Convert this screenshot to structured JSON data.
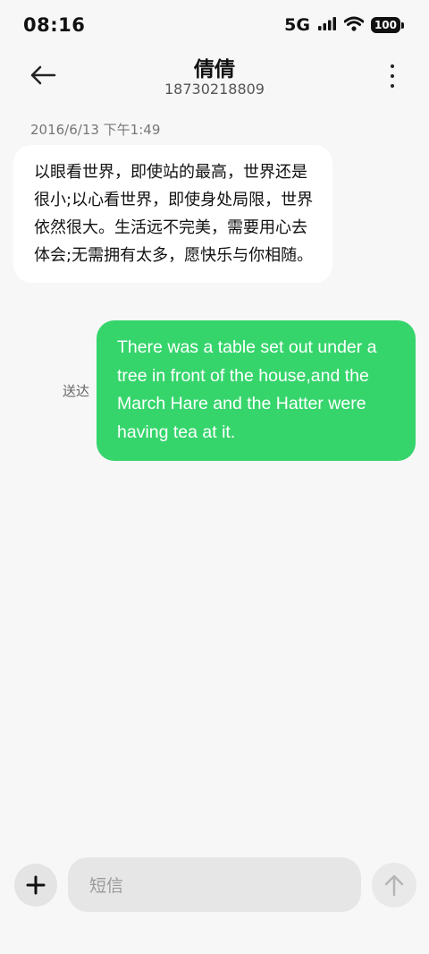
{
  "status_bar": {
    "time": "08:16",
    "network": "5G",
    "battery": "100"
  },
  "header": {
    "contact_name": "倩倩",
    "contact_number": "18730218809"
  },
  "conversation": {
    "timestamp": "2016/6/13 下午1:49",
    "incoming_message": "以眼看世界，即使站的最高，世界还是很小;以心看世界，即使身处局限，世界依然很大。生活远不完美，需要用心去体会;无需拥有太多，愿快乐与你相随。",
    "outgoing_message": "There was a table set out under a tree in front of the house,and the March Hare and the Hatter were having tea at it.",
    "outgoing_status": "送达"
  },
  "composer": {
    "placeholder": "短信"
  },
  "colors": {
    "outgoing_bubble": "#36d56c",
    "incoming_bubble": "#ffffff",
    "background": "#f7f7f7"
  }
}
